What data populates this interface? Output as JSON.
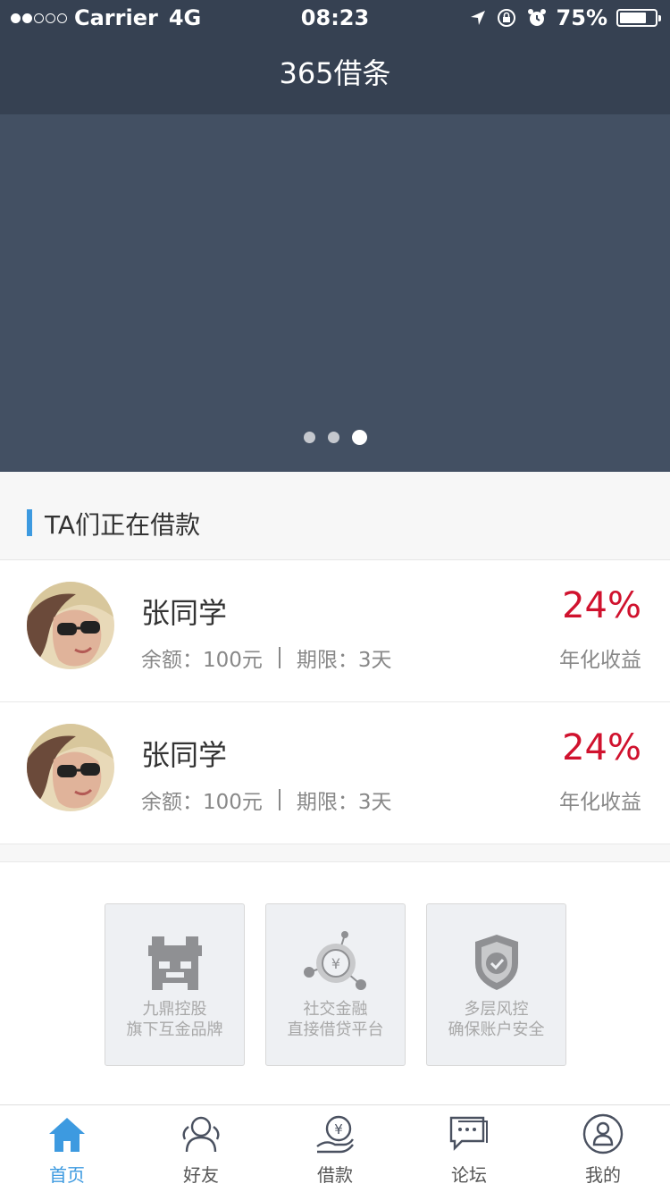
{
  "status": {
    "carrier": "Carrier",
    "network": "4G",
    "time": "08:23",
    "battery": "75%",
    "battery_level": 0.75
  },
  "nav": {
    "title": "365借条"
  },
  "banner": {
    "page_count": 3,
    "active_index": 2
  },
  "section": {
    "title": "TA们正在借款"
  },
  "loans": [
    {
      "name": "张同学",
      "balance": "余额：100元",
      "term": "期限：3天",
      "rate": "24%",
      "rate_label": "年化收益"
    },
    {
      "name": "张同学",
      "balance": "余额：100元",
      "term": "期限：3天",
      "rate": "24%",
      "rate_label": "年化收益"
    }
  ],
  "features": [
    {
      "line1": "九鼎控股",
      "line2": "旗下互金品牌",
      "icon": "building-icon"
    },
    {
      "line1": "社交金融",
      "line2": "直接借贷平台",
      "icon": "network-yuan-icon"
    },
    {
      "line1": "多层风控",
      "line2": "确保账户安全",
      "icon": "shield-icon"
    }
  ],
  "tabs": [
    {
      "label": "首页",
      "icon": "home-icon",
      "active": true
    },
    {
      "label": "好友",
      "icon": "friends-icon",
      "active": false
    },
    {
      "label": "借款",
      "icon": "loan-icon",
      "active": false
    },
    {
      "label": "论坛",
      "icon": "forum-icon",
      "active": false
    },
    {
      "label": "我的",
      "icon": "profile-icon",
      "active": false
    }
  ],
  "colors": {
    "header": "#364152",
    "banner": "#435063",
    "accent": "#3d9ae0",
    "rate": "#d0122e"
  }
}
